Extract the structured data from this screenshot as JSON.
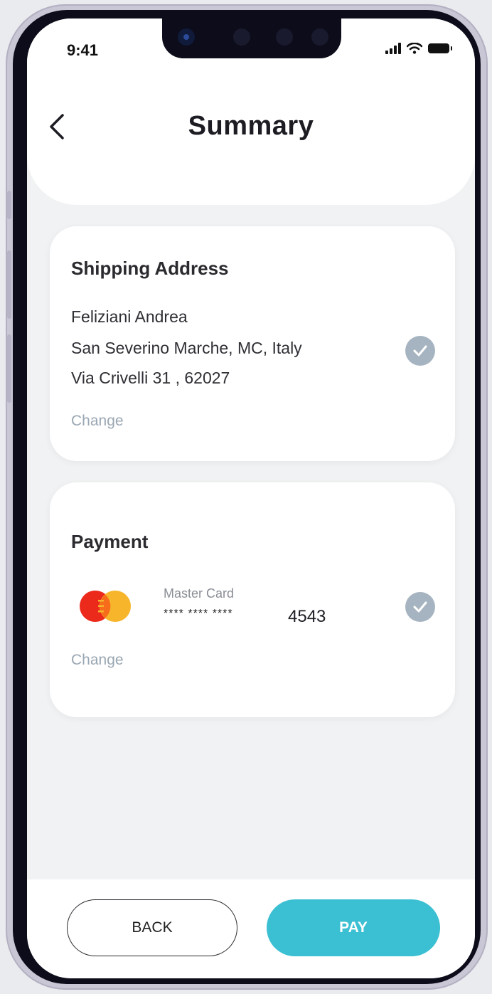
{
  "status_bar": {
    "time": "9:41"
  },
  "header": {
    "title": "Summary"
  },
  "shipping": {
    "title": "Shipping Address",
    "lines": [
      "Feliziani Andrea",
      "San Severino Marche, MC, Italy",
      "Via Crivelli 31 , 62027"
    ],
    "change_label": "Change"
  },
  "payment": {
    "title": "Payment",
    "card_brand": "Master Card",
    "masked_number": "****  ****  ****",
    "last_digits": "4543",
    "change_label": "Change"
  },
  "footer": {
    "back_label": "BACK",
    "pay_label": "PAY"
  },
  "colors": {
    "accent": "#3bbfd2",
    "check": "#a6b4c1",
    "link": "#9aa7b2"
  }
}
